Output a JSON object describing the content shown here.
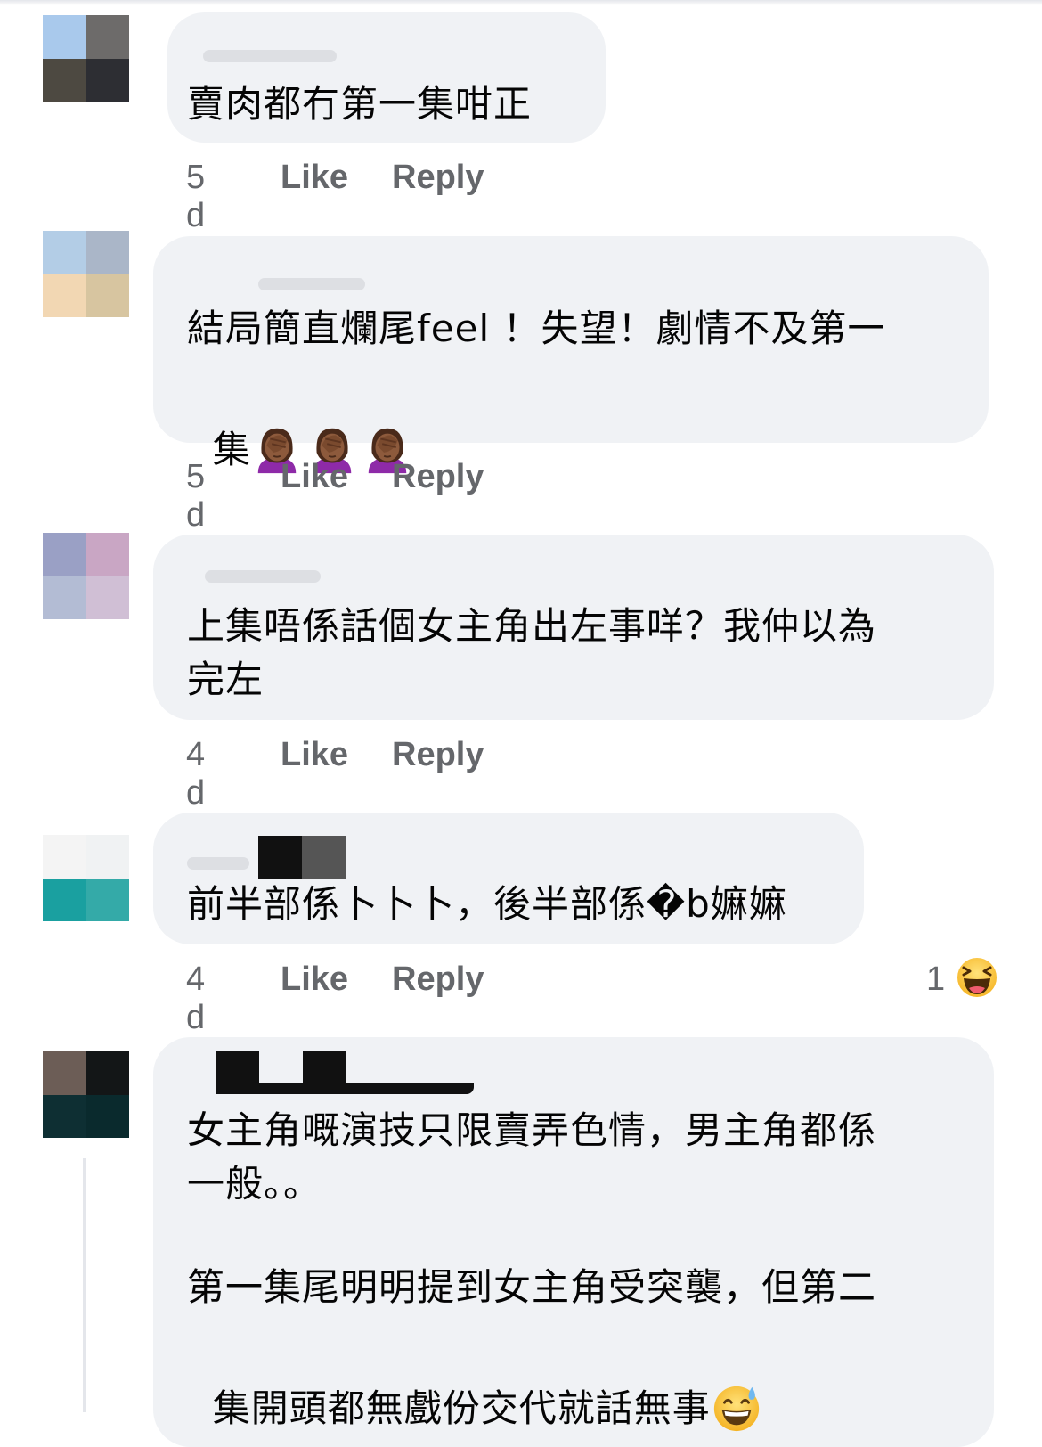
{
  "comments": [
    {
      "text": "賣肉都冇第一集咁正",
      "time": "5 d",
      "like": "Like",
      "reply": "Reply",
      "avatar_colors": [
        "#a9c9ec",
        "#6d6b6a",
        "#4d4941",
        "#2d2e33"
      ]
    },
    {
      "text_line1": "結局簡直爛尾feel ！失望！劇情不及第一",
      "text_line2": "集",
      "emoji": "woman-facepalming-icon",
      "emoji_count": 3,
      "time": "5 d",
      "like": "Like",
      "reply": "Reply",
      "avatar_colors": [
        "#b3cde6",
        "#aab6c8",
        "#f2d7b3",
        "#d7c5a0"
      ]
    },
    {
      "text_line1": "上集唔係話個女主角出左事咩？我仲以為",
      "text_line2": "完左",
      "time": "4 d",
      "like": "Like",
      "reply": "Reply",
      "avatar_colors": [
        "#9aa0c5",
        "#c9a6c4",
        "#b3bcd4",
        "#d0bfd5"
      ]
    },
    {
      "text": "前半部係卜卜卜，後半部係�b嫲嫲",
      "time": "4 d",
      "like": "Like",
      "reply": "Reply",
      "reaction_count": "1",
      "reaction": "laughing-face-icon",
      "avatar_colors": [
        "#f4f4f4",
        "#f0f2f3",
        "#1aa0a0",
        "#34aaa8"
      ]
    },
    {
      "text_line1": "女主角嘅演技只限賣弄色情，男主角都係",
      "text_line2": "一般。。",
      "text_line3": "第一集尾明明提到女主角受突襲，但第二",
      "text_line4": "集開頭都無戲份交代就話無事",
      "emoji": "grinning-sweat-icon",
      "avatar_colors": [
        "#6c5d56",
        "#131617",
        "#0e2f33",
        "#0a2a2d"
      ]
    }
  ]
}
